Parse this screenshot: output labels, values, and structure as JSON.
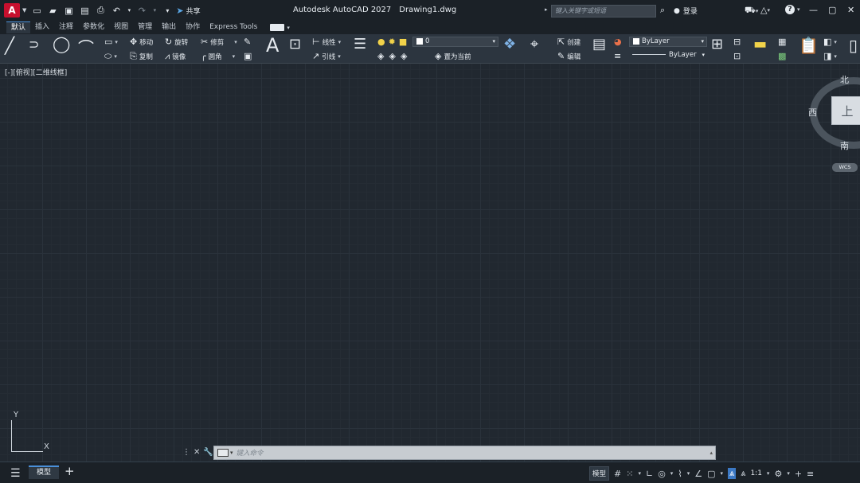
{
  "titlebar": {
    "logo": "A",
    "share_label": "共享",
    "app_title": "Autodesk AutoCAD 2027",
    "file_name": "Drawing1.dwg",
    "search_placeholder": "键入关键字或短语",
    "login_label": "登录",
    "help_glyph": "?"
  },
  "tabs": [
    {
      "label": "默认",
      "active": true
    },
    {
      "label": "插入",
      "active": false
    },
    {
      "label": "注释",
      "active": false
    },
    {
      "label": "参数化",
      "active": false
    },
    {
      "label": "视图",
      "active": false
    },
    {
      "label": "管理",
      "active": false
    },
    {
      "label": "输出",
      "active": false
    },
    {
      "label": "协作",
      "active": false
    },
    {
      "label": "Express Tools",
      "active": false
    }
  ],
  "ribbon": {
    "move": "移动",
    "rotate": "旋转",
    "trim": "修剪",
    "copy": "复制",
    "mirror": "镜像",
    "fillet": "圆角",
    "text_glyph": "A",
    "linear": "线性",
    "leader": "引线",
    "layer_value": "0",
    "set_current": "置为当前",
    "create": "创建",
    "edit": "编辑",
    "color_value": "ByLayer",
    "linetype_value": "ByLayer"
  },
  "canvas": {
    "viewport_label": "[-][俯视][二维线框]",
    "viewcube": {
      "north": "北",
      "west": "西",
      "south": "南",
      "top": "上",
      "wcs": "WCS"
    },
    "ucs": {
      "x": "X",
      "y": "Y"
    }
  },
  "command": {
    "placeholder": "键入命令",
    "close_glyph": "✕"
  },
  "statusbar": {
    "layout_tab": "模型",
    "model_button": "模型",
    "scale": "1:1"
  },
  "colors": {
    "background": "#212830",
    "titlebar": "#1b2127",
    "ribbon": "#2c353f",
    "accent": "#3c79c4",
    "logo": "#c8102e"
  }
}
